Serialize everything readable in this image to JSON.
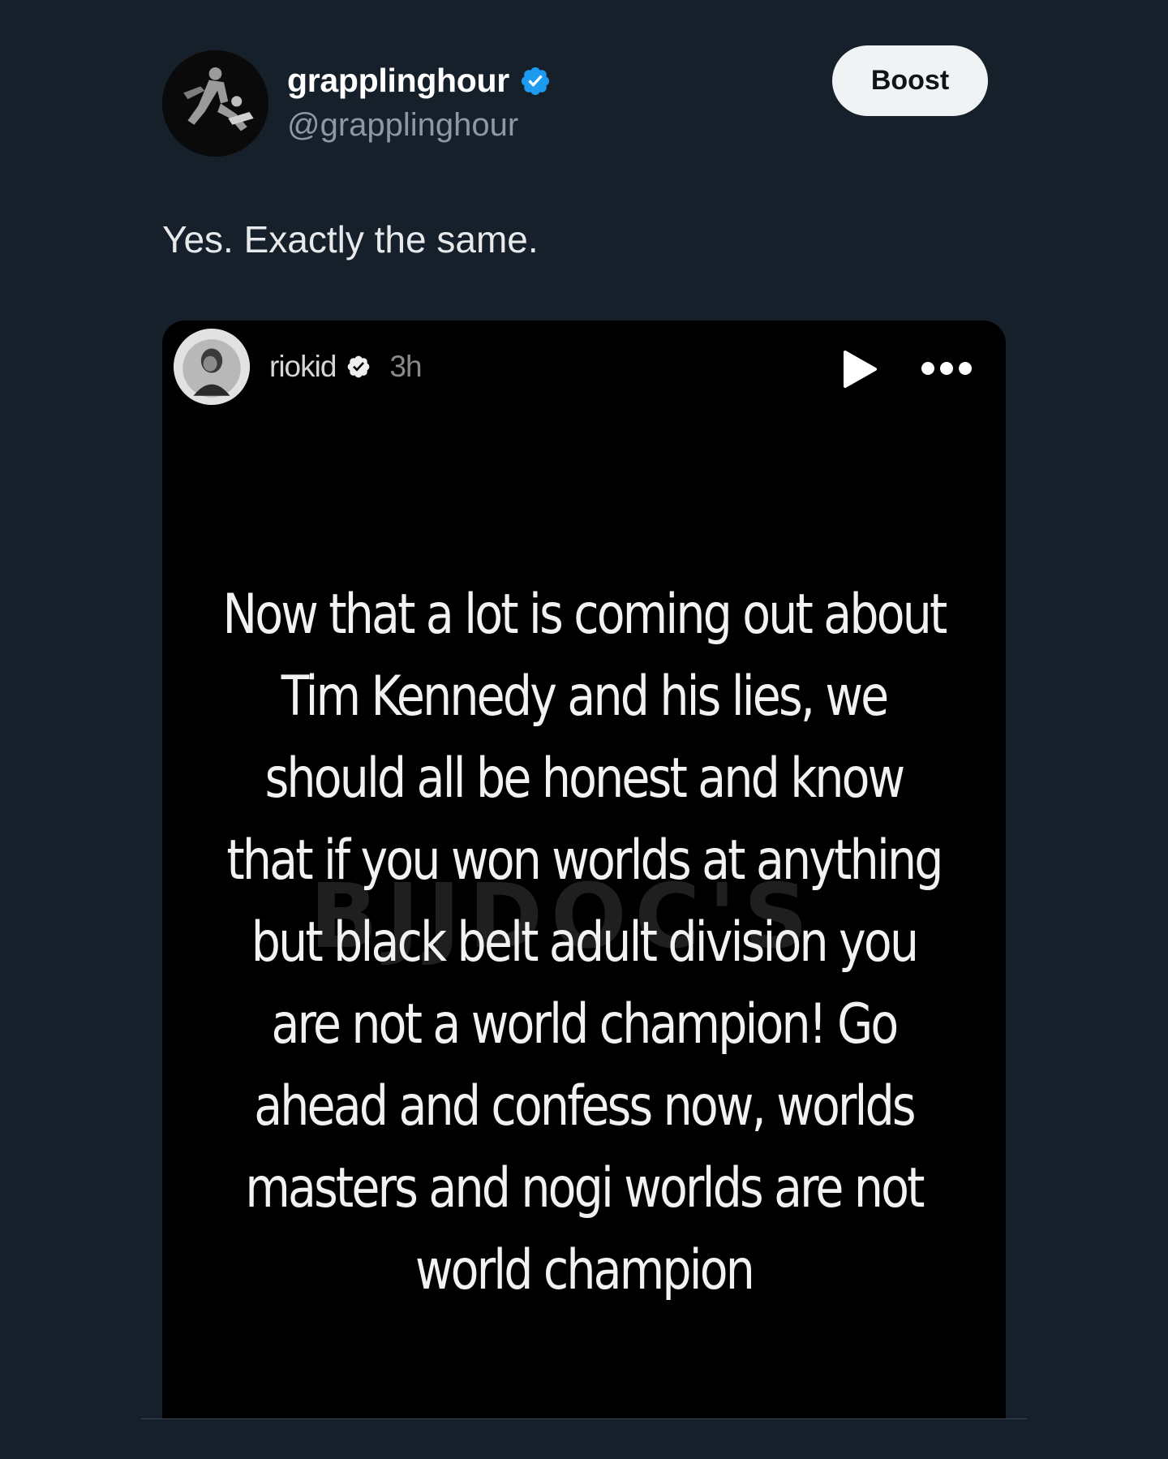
{
  "post": {
    "author": {
      "display_name": "grapplinghour",
      "handle": "@grapplinghour",
      "verified_icon": "verified-badge-icon",
      "avatar_icon": "grappling-avatar"
    },
    "boost_label": "Boost",
    "text": "Yes. Exactly the same.",
    "media": {
      "story_user": "riokid",
      "story_time": "3h",
      "story_text": "Now that a lot is coming out about Tim Kennedy and his lies, we should all be honest and know that if you won worlds at anything but black belt adult division you are not a world champion! Go ahead and confess now, worlds masters and nogi worlds are not world champion",
      "watermark": "BJJDOC'S"
    }
  },
  "colors": {
    "background": "#15202b",
    "accent_verified": "#1d9bf0",
    "text_primary": "#e7e9ea",
    "text_secondary": "#8b98a5",
    "button_bg": "#eff3f4"
  }
}
